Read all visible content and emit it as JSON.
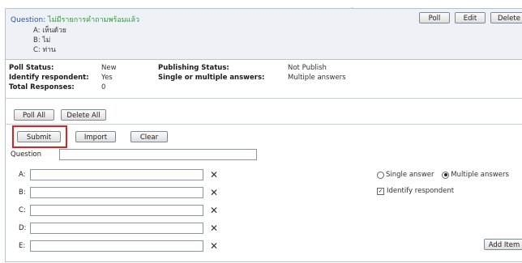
{
  "question": {
    "label": "Question:",
    "text": "ไม่มีรายการคำถามพร้อมแล้ว",
    "options": [
      "A: เห็นด้วย",
      "B: ไม่",
      "C: ท่าน"
    ]
  },
  "top_buttons": {
    "poll": "Poll",
    "edit": "Edit",
    "delete": "Delete"
  },
  "status": {
    "poll_status_label": "Poll Status:",
    "poll_status_value": "New",
    "identify_label": "Identify respondent:",
    "identify_value": "Yes",
    "total_label": "Total Responses:",
    "total_value": "0",
    "publishing_label": "Publishing Status:",
    "publishing_value": "Not Publish",
    "single_multi_label": "Single or multiple answers:",
    "single_multi_value": "Multiple answers"
  },
  "bulk_buttons": {
    "poll_all": "Poll All",
    "delete_all": "Delete All"
  },
  "form_buttons": {
    "submit": "Submit",
    "import": "Import",
    "clear": "Clear"
  },
  "form": {
    "question_label": "Question",
    "answers": [
      {
        "label": "A:",
        "value": ""
      },
      {
        "label": "B:",
        "value": ""
      },
      {
        "label": "C:",
        "value": ""
      },
      {
        "label": "D:",
        "value": ""
      },
      {
        "label": "E:",
        "value": ""
      }
    ],
    "remove_symbol": "✕",
    "single_answer_label": "Single answer",
    "multiple_answers_label": "Multiple answers",
    "answer_mode": "multiple",
    "identify_respondent_label": "Identify respondent",
    "identify_checked": true,
    "add_item": "Add Item"
  },
  "top_mark": "ฺ"
}
